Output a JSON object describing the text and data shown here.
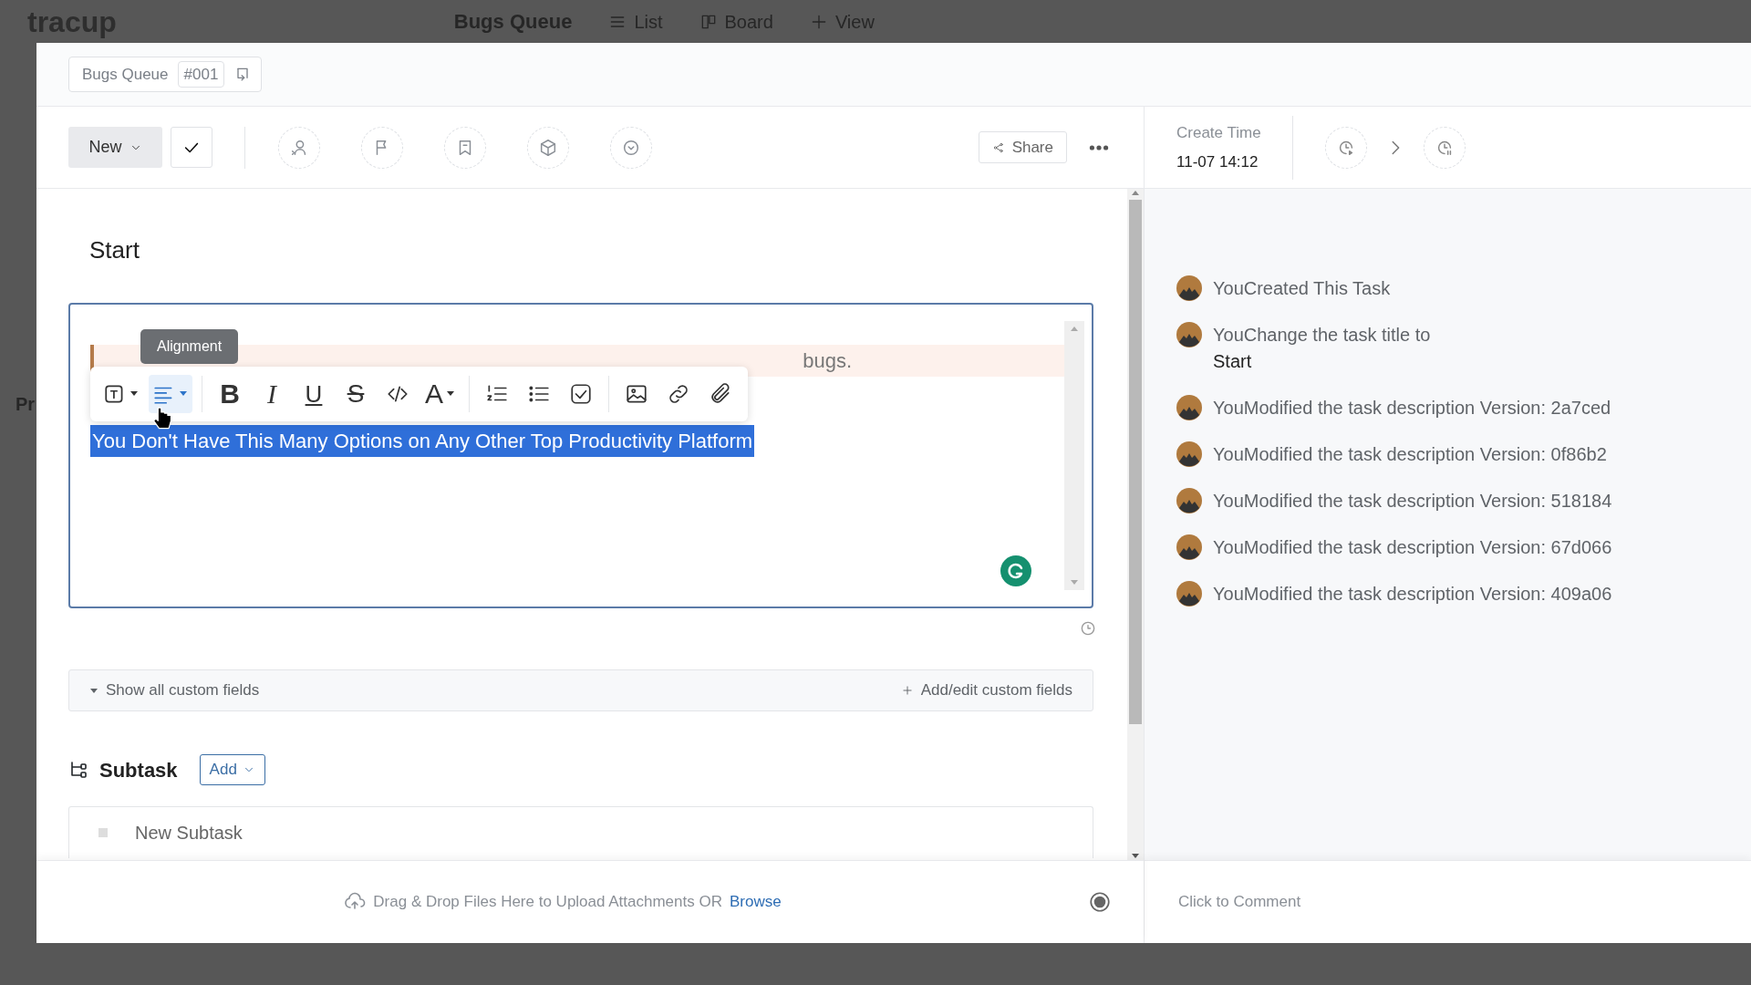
{
  "background": {
    "logo": "tracup",
    "project": "Bugs Queue",
    "views": [
      {
        "kind": "list",
        "label": "List"
      },
      {
        "kind": "board",
        "label": "Board"
      },
      {
        "kind": "add",
        "label": "View"
      }
    ],
    "sidebar_text": "Pr"
  },
  "breadcrumb": {
    "project": "Bugs Queue",
    "id": "#001"
  },
  "toolbar": {
    "status": "New",
    "share": "Share"
  },
  "create_time": {
    "label": "Create Time",
    "value": "11-07 14:12"
  },
  "task": {
    "title": "Start"
  },
  "editor": {
    "quote_tail": "bugs.",
    "tooltip": "Alignment",
    "selected_text": "You Don't Have This Many Options on Any Other Top Productivity Platform",
    "tool_groups": [
      [
        {
          "kind": "text-style",
          "highlighted": false
        },
        {
          "kind": "align",
          "highlighted": true
        }
      ],
      [
        {
          "kind": "bold",
          "glyph": "B",
          "highlighted": false
        },
        {
          "kind": "italic",
          "glyph": "I",
          "highlighted": false
        },
        {
          "kind": "underline",
          "glyph": "U",
          "highlighted": false
        },
        {
          "kind": "strike",
          "glyph": "S",
          "highlighted": false
        },
        {
          "kind": "code",
          "highlighted": false
        },
        {
          "kind": "font-color",
          "glyph": "A",
          "highlighted": false
        }
      ],
      [
        {
          "kind": "ordered-list",
          "highlighted": false
        },
        {
          "kind": "bullet-list",
          "highlighted": false
        },
        {
          "kind": "checklist",
          "highlighted": false
        }
      ],
      [
        {
          "kind": "image",
          "highlighted": false
        },
        {
          "kind": "link",
          "highlighted": false
        },
        {
          "kind": "attachment",
          "highlighted": false
        }
      ]
    ]
  },
  "activity": [
    {
      "text": "YouCreated This Task"
    },
    {
      "text": "YouChange the task title to",
      "detail": "Start"
    },
    {
      "text": "YouModified the task description Version: 2a7ced"
    },
    {
      "text": "YouModified the task description Version: 0f86b2"
    },
    {
      "text": "YouModified the task description Version: 518184"
    },
    {
      "text": "YouModified the task description Version: 67d066"
    },
    {
      "text": "YouModified the task description Version: 409a06"
    }
  ],
  "custom_fields": {
    "toggle": "Show all custom fields",
    "edit": "Add/edit custom fields"
  },
  "subtask": {
    "title": "Subtask",
    "add": "Add",
    "placeholder": "New Subtask"
  },
  "footer": {
    "upload": "Drag & Drop Files Here to Upload Attachments OR",
    "browse": "Browse",
    "comment_placeholder": "Click to Comment"
  }
}
